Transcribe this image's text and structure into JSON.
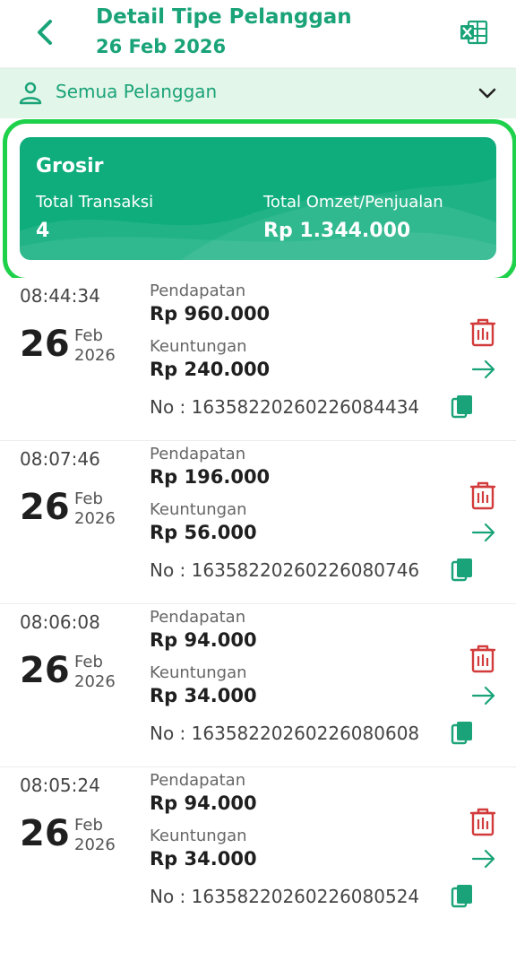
{
  "header": {
    "title": "Detail Tipe Pelanggan",
    "date": "26 Feb 2026",
    "back_icon": "back-chevron-icon",
    "export_icon": "excel-icon"
  },
  "filter": {
    "label": "Semua Pelanggan",
    "icon": "person-icon",
    "chevron": "chevron-down-icon"
  },
  "summary": {
    "title": "Grosir",
    "total_transaksi_label": "Total Transaksi",
    "total_transaksi_value": "4",
    "total_omzet_label": "Total Omzet/Penjualan",
    "total_omzet_value": "Rp 1.344.000"
  },
  "colors": {
    "primary": "#1aa378",
    "card": "#0fad7c",
    "highlight": "#1ed14a",
    "filter_bg": "#e3f6ea",
    "delete": "#d23b3b"
  },
  "labels": {
    "pendapatan": "Pendapatan",
    "keuntungan": "Keuntungan",
    "no_prefix": "No :"
  },
  "transactions": [
    {
      "time": "08:44:34",
      "day": "26",
      "month": "Feb",
      "year": "2026",
      "pendapatan": "Rp 960.000",
      "keuntungan": "Rp 240.000",
      "no": "16358220260226084434"
    },
    {
      "time": "08:07:46",
      "day": "26",
      "month": "Feb",
      "year": "2026",
      "pendapatan": "Rp 196.000",
      "keuntungan": "Rp 56.000",
      "no": "16358220260226080746"
    },
    {
      "time": "08:06:08",
      "day": "26",
      "month": "Feb",
      "year": "2026",
      "pendapatan": "Rp 94.000",
      "keuntungan": "Rp 34.000",
      "no": "16358220260226080608"
    },
    {
      "time": "08:05:24",
      "day": "26",
      "month": "Feb",
      "year": "2026",
      "pendapatan": "Rp 94.000",
      "keuntungan": "Rp 34.000",
      "no": "16358220260226080524"
    }
  ]
}
